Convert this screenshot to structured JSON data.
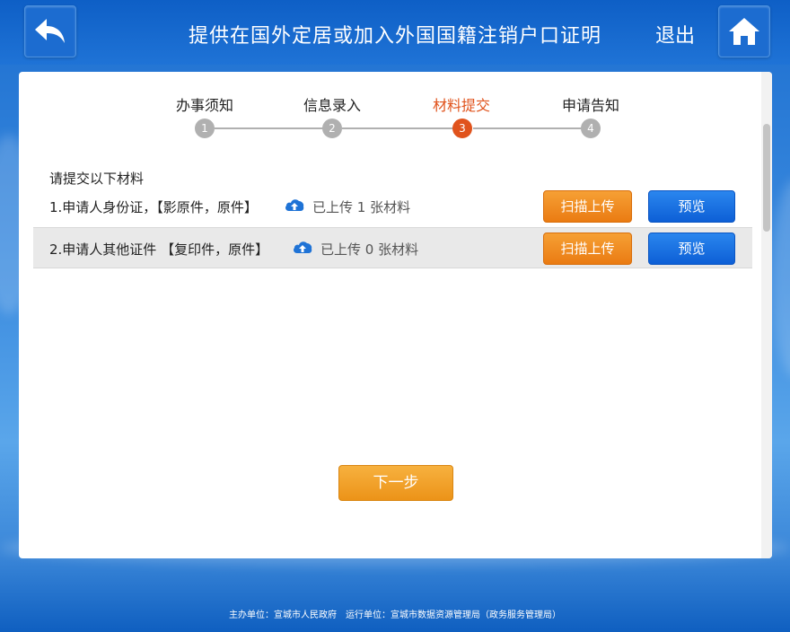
{
  "header": {
    "title": "提供在国外定居或加入外国国籍注销户口证明",
    "exit_label": "退出",
    "back_icon": "back-arrow-icon",
    "home_icon": "home-icon"
  },
  "steps": [
    {
      "label": "办事须知",
      "number": "1",
      "state": "done"
    },
    {
      "label": "信息录入",
      "number": "2",
      "state": "done"
    },
    {
      "label": "材料提交",
      "number": "3",
      "state": "active"
    },
    {
      "label": "申请告知",
      "number": "4",
      "state": "todo"
    }
  ],
  "materials": {
    "intro": "请提交以下材料",
    "items": [
      {
        "text": "1.申请人身份证，【影原件，原件】",
        "uploaded": "已上传 1 张材料",
        "scan_label": "扫描上传",
        "preview_label": "预览"
      },
      {
        "text": "2.申请人其他证件 【复印件，原件】",
        "uploaded": "已上传 0 张材料",
        "scan_label": "扫描上传",
        "preview_label": "预览"
      }
    ]
  },
  "next_label": "下一步",
  "footer": "主办单位：宣城市人民政府　运行单位：宣城市数据资源管理局（政务服务管理局）",
  "colors": {
    "active_step": "#e0531c",
    "scan_button": "#ea7b12",
    "preview_button": "#0d5fd6",
    "next_button": "#ec9318",
    "header": "#1f73d6"
  }
}
